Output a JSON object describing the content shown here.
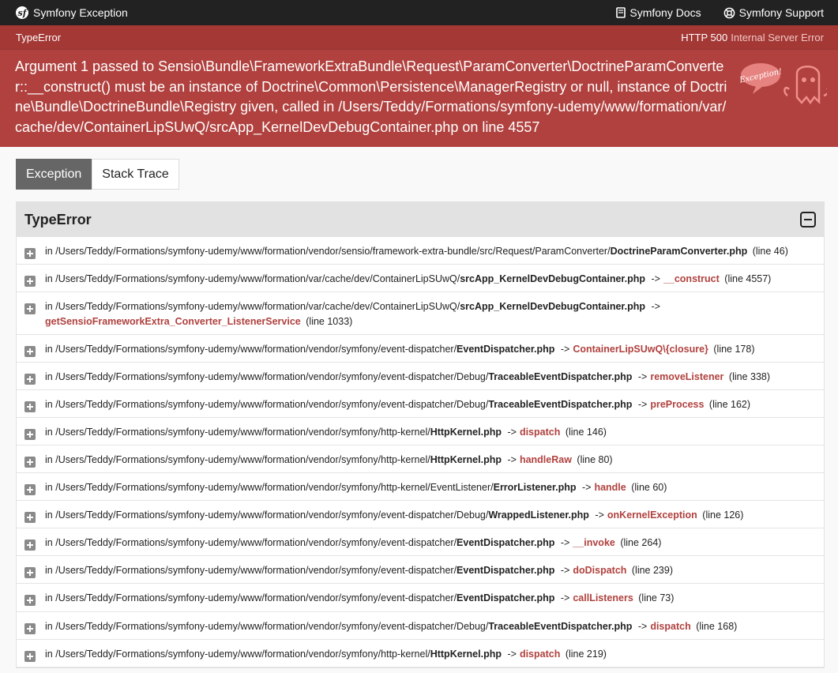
{
  "topbar": {
    "brand": "Symfony Exception",
    "docs_label": "Symfony Docs",
    "support_label": "Symfony Support"
  },
  "error": {
    "class": "TypeError",
    "status_code": "HTTP 500",
    "status_text": "Internal Server Error",
    "message": "Argument 1 passed to Sensio\\Bundle\\FrameworkExtraBundle\\Request\\ParamConverter\\DoctrineParamConverter::__construct() must be an instance of Doctrine\\Common\\Persistence\\ManagerRegistry or null, instance of Doctrine\\Bundle\\DoctrineBundle\\Registry given, called in /Users/Teddy/Formations/symfony-udemy/www/formation/var/cache/dev/ContainerLipSUwQ/srcApp_KernelDevDebugContainer.php on line 4557",
    "ghost_text": "Exception!"
  },
  "tabs": [
    {
      "label": "Exception",
      "active": true
    },
    {
      "label": "Stack Trace",
      "active": false
    }
  ],
  "panel": {
    "title": "TypeError"
  },
  "trace": [
    {
      "prefix": "in",
      "path": "/Users/Teddy/Formations/symfony-udemy/www/formation/vendor/sensio/framework-extra-bundle/src/Request/ParamConverter/",
      "file": "DoctrineParamConverter.php",
      "arrow": "",
      "fn": "",
      "line": "(line 46)"
    },
    {
      "prefix": "in",
      "path": "/Users/Teddy/Formations/symfony-udemy/www/formation/var/cache/dev/ContainerLipSUwQ/",
      "file": "srcApp_KernelDevDebugContainer.php",
      "arrow": "->",
      "fn": "__construct",
      "line": "(line 4557)"
    },
    {
      "prefix": "in",
      "path": "/Users/Teddy/Formations/symfony-udemy/www/formation/var/cache/dev/ContainerLipSUwQ/",
      "file": "srcApp_KernelDevDebugContainer.php",
      "arrow": "->",
      "fn": "getSensioFrameworkExtra_Converter_ListenerService",
      "line": "(line 1033)",
      "wrap": true
    },
    {
      "prefix": "in",
      "path": "/Users/Teddy/Formations/symfony-udemy/www/formation/vendor/symfony/event-dispatcher/",
      "file": "EventDispatcher.php",
      "arrow": "->",
      "fn": "ContainerLipSUwQ\\{closure}",
      "line": "(line 178)"
    },
    {
      "prefix": "in",
      "path": "/Users/Teddy/Formations/symfony-udemy/www/formation/vendor/symfony/event-dispatcher/Debug/",
      "file": "TraceableEventDispatcher.php",
      "arrow": "->",
      "fn": "removeListener",
      "line": "(line 338)"
    },
    {
      "prefix": "in",
      "path": "/Users/Teddy/Formations/symfony-udemy/www/formation/vendor/symfony/event-dispatcher/Debug/",
      "file": "TraceableEventDispatcher.php",
      "arrow": "->",
      "fn": "preProcess",
      "line": "(line 162)"
    },
    {
      "prefix": "in",
      "path": "/Users/Teddy/Formations/symfony-udemy/www/formation/vendor/symfony/http-kernel/",
      "file": "HttpKernel.php",
      "arrow": "->",
      "fn": "dispatch",
      "line": "(line 146)"
    },
    {
      "prefix": "in",
      "path": "/Users/Teddy/Formations/symfony-udemy/www/formation/vendor/symfony/http-kernel/",
      "file": "HttpKernel.php",
      "arrow": "->",
      "fn": "handleRaw",
      "line": "(line 80)"
    },
    {
      "prefix": "in",
      "path": "/Users/Teddy/Formations/symfony-udemy/www/formation/vendor/symfony/http-kernel/EventListener/",
      "file": "ErrorListener.php",
      "arrow": "->",
      "fn": "handle",
      "line": "(line 60)"
    },
    {
      "prefix": "in",
      "path": "/Users/Teddy/Formations/symfony-udemy/www/formation/vendor/symfony/event-dispatcher/Debug/",
      "file": "WrappedListener.php",
      "arrow": "->",
      "fn": "onKernelException",
      "line": "(line 126)"
    },
    {
      "prefix": "in",
      "path": "/Users/Teddy/Formations/symfony-udemy/www/formation/vendor/symfony/event-dispatcher/",
      "file": "EventDispatcher.php",
      "arrow": "->",
      "fn": "__invoke",
      "line": "(line 264)"
    },
    {
      "prefix": "in",
      "path": "/Users/Teddy/Formations/symfony-udemy/www/formation/vendor/symfony/event-dispatcher/",
      "file": "EventDispatcher.php",
      "arrow": "->",
      "fn": "doDispatch",
      "line": "(line 239)"
    },
    {
      "prefix": "in",
      "path": "/Users/Teddy/Formations/symfony-udemy/www/formation/vendor/symfony/event-dispatcher/",
      "file": "EventDispatcher.php",
      "arrow": "->",
      "fn": "callListeners",
      "line": "(line 73)"
    },
    {
      "prefix": "in",
      "path": "/Users/Teddy/Formations/symfony-udemy/www/formation/vendor/symfony/event-dispatcher/Debug/",
      "file": "TraceableEventDispatcher.php",
      "arrow": "->",
      "fn": "dispatch",
      "line": "(line 168)"
    },
    {
      "prefix": "in",
      "path": "/Users/Teddy/Formations/symfony-udemy/www/formation/vendor/symfony/http-kernel/",
      "file": "HttpKernel.php",
      "arrow": "->",
      "fn": "dispatch",
      "line": "(line 219)"
    }
  ],
  "colors": {
    "topbar_bg": "#222222",
    "header_bg": "#b0413e",
    "function_color": "#b0413e",
    "tab_active_bg": "#666666"
  },
  "icons": {
    "brand": "symfony-logo-icon",
    "docs": "book-icon",
    "support": "lifebuoy-icon",
    "ghost": "ghost-icon",
    "collapse": "collapse-icon",
    "expand": "expand-icon"
  }
}
